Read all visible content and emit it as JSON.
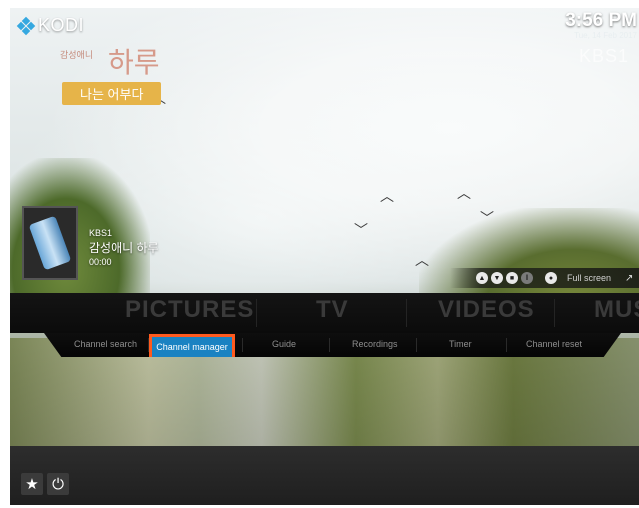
{
  "app": {
    "name": "KODI"
  },
  "clock": {
    "time": "3:56 PM",
    "date": "Tue, 14 Feb 2017"
  },
  "channel_watermark": "KBS1",
  "background_show": {
    "title_small": "감성애니",
    "title_big": "하루",
    "tag": "나는 어부다"
  },
  "now_playing": {
    "channel": "KBS1",
    "title": "감성애니 하루",
    "time": "00:00"
  },
  "player_controls": {
    "buttons": [
      "prev-icon",
      "next-icon",
      "stop-icon",
      "pause-icon",
      "record-icon"
    ],
    "fullscreen_label": "Full screen"
  },
  "main_menu": {
    "items": [
      "PICTURES",
      "TV",
      "VIDEOS",
      "MUS"
    ]
  },
  "sub_menu": {
    "items": [
      "Channel search",
      "Channel manager",
      "Guide",
      "Recordings",
      "Timer",
      "Channel reset"
    ],
    "active": "Channel manager"
  },
  "bottom_bar": {
    "buttons": [
      "favourites-icon",
      "power-icon"
    ]
  },
  "colors": {
    "accent": "#1a82c2",
    "focus_border": "#ff5a1e",
    "tag_bg": "#e6b449"
  }
}
